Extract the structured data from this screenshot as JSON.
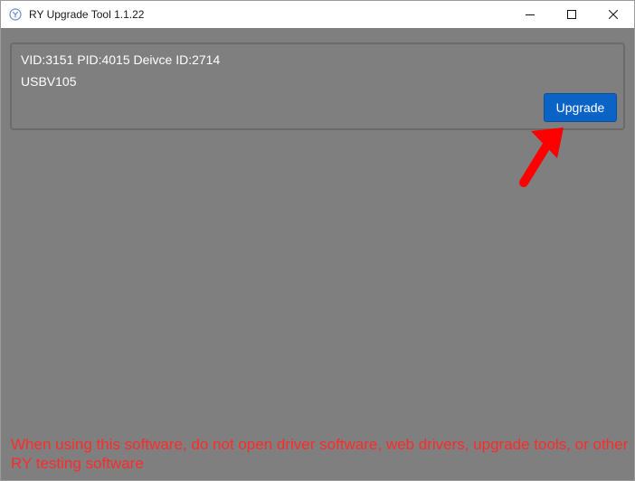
{
  "window": {
    "title": "RY Upgrade Tool 1.1.22",
    "app_icon": "app-logo-icon",
    "controls": {
      "minimize_icon": "minimize-icon",
      "maximize_icon": "maximize-icon",
      "close_icon": "close-icon"
    }
  },
  "device": {
    "ids": "VID:3151 PID:4015  Deivce ID:2714",
    "name": "USBV105",
    "upgrade_label": "Upgrade"
  },
  "annotation": {
    "arrow_icon": "red-arrow-icon",
    "arrow_color": "#ff0000"
  },
  "footer": {
    "warning": "When using this software, do not open driver software, web drivers, upgrade tools, or other RY testing software",
    "warning_color": "#ff2a2a"
  },
  "colors": {
    "background": "#7f7f7f",
    "accent": "#0b63c5"
  }
}
